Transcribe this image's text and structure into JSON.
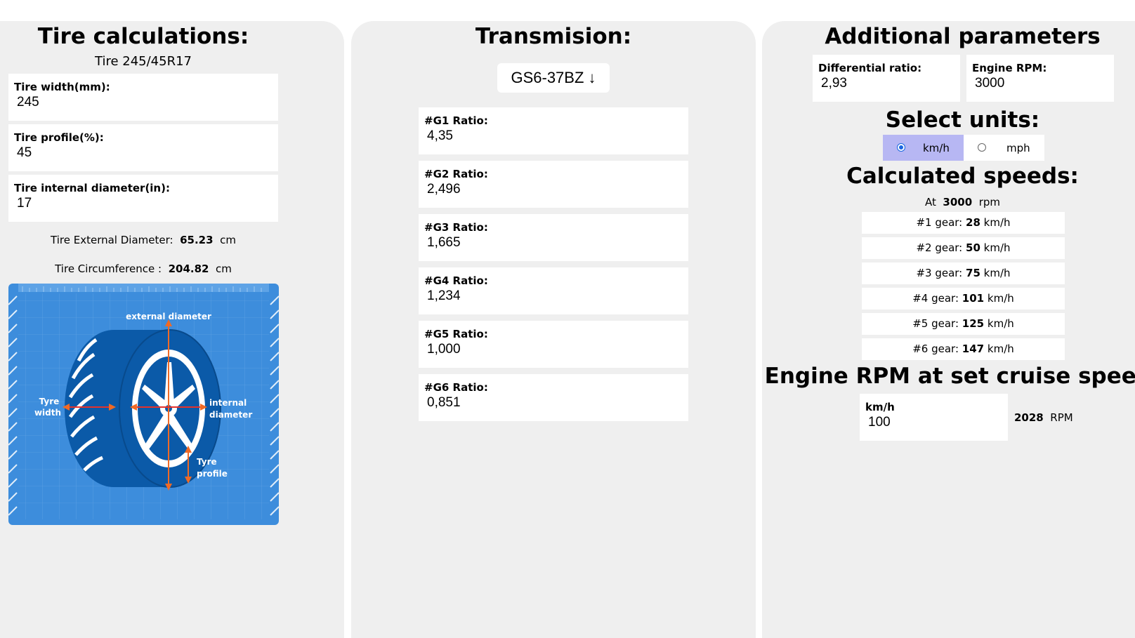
{
  "tire": {
    "title": "Tire calculations:",
    "subtitle": "Tire 245/45R17",
    "fields": [
      {
        "label": "Tire width(mm):",
        "value": "245"
      },
      {
        "label": "Tire profile(%):",
        "value": "45"
      },
      {
        "label": "Tire internal diameter(in):",
        "value": "17"
      }
    ],
    "external_label": "Tire External Diameter:",
    "external_value": "65.23",
    "external_unit": "cm",
    "circ_label": "Tire Circumference :",
    "circ_value": "204.82",
    "circ_unit": "cm",
    "diagram_labels": {
      "external": "external diameter",
      "tyre": "Tyre",
      "width": "width",
      "internal": "internal",
      "diameter": "diameter",
      "tyre2": "Tyre",
      "profile": "profile"
    }
  },
  "transmission": {
    "title": "Transmision:",
    "selected": "GS6-37BZ ↓",
    "gears": [
      {
        "label": "#G1 Ratio:",
        "value": "4,35"
      },
      {
        "label": "#G2 Ratio:",
        "value": "2,496"
      },
      {
        "label": "#G3 Ratio:",
        "value": "1,665"
      },
      {
        "label": "#G4 Ratio:",
        "value": "1,234"
      },
      {
        "label": "#G5 Ratio:",
        "value": "1,000"
      },
      {
        "label": "#G6 Ratio:",
        "value": "0,851"
      }
    ]
  },
  "additional": {
    "title": "Additional parameters",
    "diff_label": "Differential ratio:",
    "diff_value": "2,93",
    "rpm_label": "Engine RPM:",
    "rpm_value": "3000",
    "units_title": "Select units:",
    "unit_kmh": "km/h",
    "unit_mph": "mph",
    "selected_unit": "km/h",
    "speeds_title": "Calculated speeds:",
    "at_label": "At",
    "at_value": "3000",
    "at_unit": "rpm",
    "speeds": [
      {
        "gear": "#1 gear:",
        "speed": "28",
        "unit": "km/h"
      },
      {
        "gear": "#2 gear:",
        "speed": "50",
        "unit": "km/h"
      },
      {
        "gear": "#3 gear:",
        "speed": "75",
        "unit": "km/h"
      },
      {
        "gear": "#4 gear:",
        "speed": "101",
        "unit": "km/h"
      },
      {
        "gear": "#5 gear:",
        "speed": "125",
        "unit": "km/h"
      },
      {
        "gear": "#6 gear:",
        "speed": "147",
        "unit": "km/h"
      }
    ],
    "cruise_title": "Engine RPM at set cruise speed:",
    "cruise_label": "km/h",
    "cruise_value": "100",
    "cruise_rpm": "2028",
    "cruise_rpm_unit": "RPM"
  },
  "colors": {
    "panel": "#efefef",
    "selected_unit_bg": "#b7b7f3",
    "diagram_bg": "#3d8ddc",
    "tire_dark": "#0b5aa8",
    "arrow": "#f06a25"
  }
}
